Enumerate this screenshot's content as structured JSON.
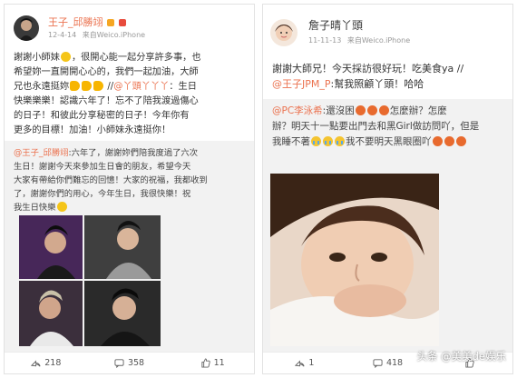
{
  "left_post": {
    "author": "王子_邱勝翊",
    "date": "12-4-14",
    "source": "来自Weico.iPhone",
    "text_lines": [
      "謝謝小師妹",
      "，很開心能一起分享許多事，也",
      "希望妳一直開開心心的，我們一起加油，大師",
      "兄也永遠挺妳",
      "//",
      "@丫頭丫丫丫",
      "：生日",
      "快樂樂樂",
      "！認識六年了！忘不了陪我渡過傷心",
      "的日子！和彼此分享秘密的日子！今年你有",
      "更多的目標！加油！小師妹永遠挺你！"
    ],
    "quote_lines": [
      "@王子_邱勝翊",
      ":六年了，謝謝妳們陪我度過了六次",
      "生日！謝謝今天來參加生日會的朋友，希望今天",
      "大家有帶給你們難忘的回憶！大家的祝福，我都收到",
      "了，謝謝你們的用心，今年生日，我很快樂！祝",
      "我生日快樂"
    ],
    "footer": {
      "repost_count": "218",
      "comment_count": "358",
      "like_count": "11"
    }
  },
  "right_post": {
    "author": "詹子晴丫頭",
    "date": "11-11-13",
    "source": "来自Weico.iPhone",
    "text_lines": [
      "謝謝大師兄！今天採訪很好玩！吃美食ya //",
      "@王子JPM_P",
      ":幫我照顧丫頭！哈哈"
    ],
    "quote_lines": [
      "@PC李泳希",
      ":還沒困",
      "怎麼辦？怎麼",
      "辦？明天十一點要出門去和黑Girl做訪問吖，但是",
      "我睡不著",
      "我不要明天黑眼圈吖"
    ],
    "footer": {
      "repost_count": "1",
      "comment_count": "418",
      "like_count": ""
    }
  },
  "watermark": "头条 @美美de娱乐",
  "colors": {
    "mention": "#eb7350",
    "quote_bg": "#f2f2f2",
    "border": "#e2e2e2"
  },
  "icons": [
    "repost-icon",
    "comment-icon",
    "like-icon",
    "verified-badge-icon",
    "vip-badge-icon"
  ]
}
